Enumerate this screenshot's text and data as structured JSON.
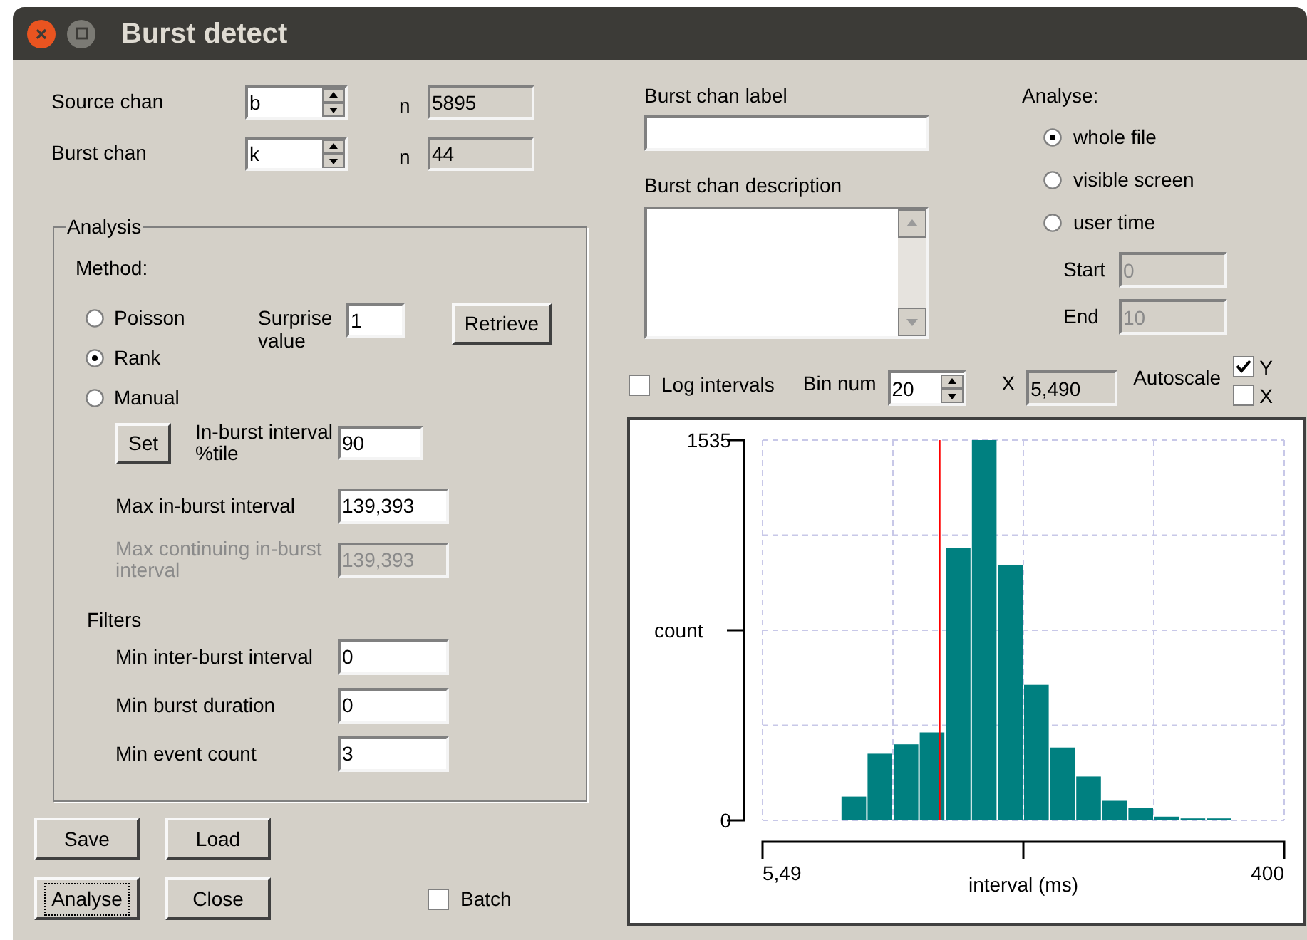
{
  "window": {
    "title": "Burst detect"
  },
  "channels": [
    {
      "label": "Source chan",
      "value": "b",
      "n_label": "n",
      "n": "5895"
    },
    {
      "label": "Burst chan",
      "value": "k",
      "n_label": "n",
      "n": "44"
    }
  ],
  "analysis": {
    "legend": "Analysis",
    "method_label": "Method:",
    "methods": [
      {
        "label": "Poisson",
        "selected": false
      },
      {
        "label": "Rank",
        "selected": true
      },
      {
        "label": "Manual",
        "selected": false
      }
    ],
    "surprise": {
      "label": "Surprise value",
      "value": "1"
    },
    "retrieve_button": "Retrieve",
    "set_button": "Set",
    "in_burst_percentile": {
      "label": "In-burst interval %tile",
      "value": "90"
    },
    "params": [
      {
        "label": "Max in-burst interval",
        "value": "139,393",
        "disabled": false
      },
      {
        "label": "Max continuing in-burst interval",
        "value": "139,393",
        "disabled": true
      }
    ],
    "filters_label": "Filters",
    "filters": [
      {
        "label": "Min inter-burst interval",
        "value": "0"
      },
      {
        "label": "Min burst duration",
        "value": "0"
      },
      {
        "label": "Min event count",
        "value": "3"
      }
    ]
  },
  "buttons": [
    {
      "label": "Save",
      "focused": false
    },
    {
      "label": "Load",
      "focused": false
    },
    {
      "label": "Analyse",
      "focused": true
    },
    {
      "label": "Close",
      "focused": false
    }
  ],
  "batch": {
    "label": "Batch",
    "checked": false
  },
  "burst_label": {
    "label": "Burst chan label"
  },
  "burst_description": {
    "label": "Burst chan description"
  },
  "analyse": {
    "label": "Analyse:",
    "options": [
      {
        "label": "whole file",
        "selected": true
      },
      {
        "label": "visible screen",
        "selected": false
      },
      {
        "label": "user time",
        "selected": false
      }
    ],
    "start": {
      "label": "Start",
      "value": "0",
      "disabled": true
    },
    "end": {
      "label": "End",
      "value": "10",
      "disabled": true
    }
  },
  "histogram_controls": {
    "log_intervals": {
      "label": "Log intervals",
      "checked": false
    },
    "bin_num": {
      "label": "Bin num",
      "value": "20"
    },
    "x": {
      "label": "X",
      "value": "5,490"
    },
    "autoscale": {
      "label": "Autoscale",
      "options": [
        {
          "label": "Y",
          "checked": true
        },
        {
          "label": "X",
          "checked": false
        }
      ]
    }
  },
  "histogram": {
    "x_range_labels": [
      "5,49",
      "400"
    ],
    "chart_data": {
      "type": "bar",
      "xlabel": "interval (ms)",
      "ylabel": "count",
      "values": [
        0,
        0,
        0,
        96,
        269,
        307,
        355,
        1099,
        1535,
        1032,
        547,
        294,
        177,
        79,
        50,
        15,
        8,
        8,
        0,
        0
      ],
      "ylim": [
        0,
        1535
      ],
      "yticks": [
        0,
        1535
      ]
    }
  }
}
